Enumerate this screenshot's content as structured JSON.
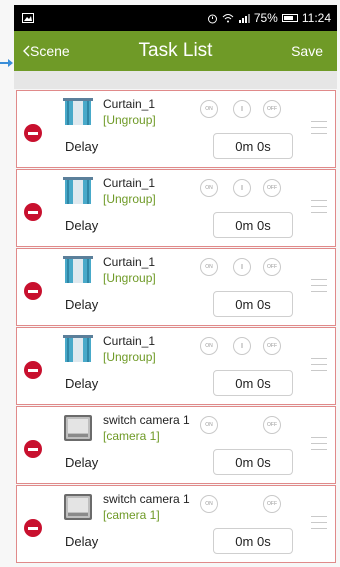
{
  "status_bar": {
    "battery_percent": "75%",
    "time": "11:24"
  },
  "header": {
    "back_label": "Scene",
    "title": "Task List",
    "save_label": "Save"
  },
  "tasks": [
    {
      "name": "Curtain_1",
      "group": "[Ungroup]",
      "device_icon": "curtain-icon",
      "controls": [
        "ON",
        "||",
        "OFF"
      ],
      "delay_label": "Delay",
      "delay_value": "0m 0s"
    },
    {
      "name": "Curtain_1",
      "group": "[Ungroup]",
      "device_icon": "curtain-icon",
      "controls": [
        "ON",
        "||",
        "OFF"
      ],
      "delay_label": "Delay",
      "delay_value": "0m 0s"
    },
    {
      "name": "Curtain_1",
      "group": "[Ungroup]",
      "device_icon": "curtain-icon",
      "controls": [
        "ON",
        "||",
        "OFF"
      ],
      "delay_label": "Delay",
      "delay_value": "0m 0s"
    },
    {
      "name": "Curtain_1",
      "group": "[Ungroup]",
      "device_icon": "curtain-icon",
      "controls": [
        "ON",
        "||",
        "OFF"
      ],
      "delay_label": "Delay",
      "delay_value": "0m 0s"
    },
    {
      "name": "switch camera 1",
      "group": "[camera 1]",
      "device_icon": "switch-icon",
      "controls": [
        "ON",
        "OFF"
      ],
      "delay_label": "Delay",
      "delay_value": "0m 0s"
    },
    {
      "name": "switch camera 1",
      "group": "[camera 1]",
      "device_icon": "switch-icon",
      "controls": [
        "ON",
        "OFF"
      ],
      "delay_label": "Delay",
      "delay_value": "0m 0s"
    }
  ],
  "colors": {
    "header_green": "#6f9a27",
    "group_green": "#6f9a27",
    "remove_red": "#c8102e",
    "row_border": "#e08a8a"
  }
}
